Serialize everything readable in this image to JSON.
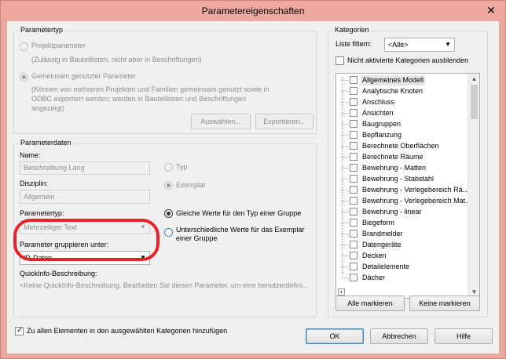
{
  "window": {
    "title": "Parametereigenschaften",
    "close_glyph": "✕"
  },
  "parametertyp": {
    "legend": "Parametertyp",
    "projekt_label": "Projektparameter",
    "projekt_desc": "(Zulässig in Bauteillisten, nicht aber in Beschriftungen)",
    "gemeinsam_label": "Gemeinsam genutzter Parameter",
    "gemeinsam_desc_1": "(Können von mehreren Projekten und Familien gemeinsam genutzt sowie in",
    "gemeinsam_desc_2": "ODBC exportiert werden; werden in Bauteillisten und Beschriftungen",
    "gemeinsam_desc_3": "angezeigt)",
    "auswaehlen_btn": "Auswählen...",
    "exportieren_btn": "Exportieren..."
  },
  "parameterdaten": {
    "legend": "Parameterdaten",
    "name_label": "Name:",
    "name_value": "Beschreibung Lang",
    "disziplin_label": "Disziplin:",
    "disziplin_value": "Allgemein",
    "typ_label": "Typ",
    "exemplar_label": "Exemplar",
    "parametertyp_label": "Parametertyp:",
    "parametertyp_value": "Mehrzeiliger Text",
    "gruppieren_label": "Parameter gruppieren unter:",
    "gruppieren_value": "ID-Daten",
    "gleiche_werte_label": "Gleiche Werte für den Typ einer Gruppe",
    "unterschiedliche_label_1": "Unterschiedliche Werte für das Exemplar",
    "unterschiedliche_label_2": "einer Gruppe",
    "quickinfo_label": "QuickInfo-Beschreibung:",
    "quickinfo_value": "<Keine QuickInfo-Beschreibung. Bearbeiten Sie diesen Parameter, um eine benutzerdefini..."
  },
  "kategorien": {
    "legend": "Kategorien",
    "filter_label": "Liste filtern:",
    "filter_value": "<Alle>",
    "hide_inactive_label": "Nicht aktivierte Kategorien ausblenden",
    "items": [
      "Allgemeines Modell",
      "Analytische Knoten",
      "Anschluss",
      "Ansichten",
      "Baugruppen",
      "Bepflanzung",
      "Berechnete Oberflächen",
      "Berechnete Räume",
      "Bewehrung - Matten",
      "Bewehrung - Stabstahl",
      "Bewehrung - Verlegebereich Rä...",
      "Bewehrung - Verlegebereich Mat...",
      "Bewehrung - linear",
      "Biegeform",
      "Brandmelder",
      "Datengeräte",
      "Decken",
      "Detailelemente",
      "Dächer"
    ],
    "expander_glyph": "+",
    "alle_markieren_btn": "Alle markieren",
    "keine_markieren_btn": "Keine markieren"
  },
  "footer": {
    "add_all_label": "Zu allen Elementen in den ausgewählten Kategorien hinzufügen",
    "ok_btn": "OK",
    "abbrechen_btn": "Abbrechen",
    "hilfe_btn": "Hilfe"
  },
  "colors": {
    "titlebar": "#eda89f",
    "highlight_ellipse": "#e4232b",
    "client_bg": "#f0f0f0"
  }
}
